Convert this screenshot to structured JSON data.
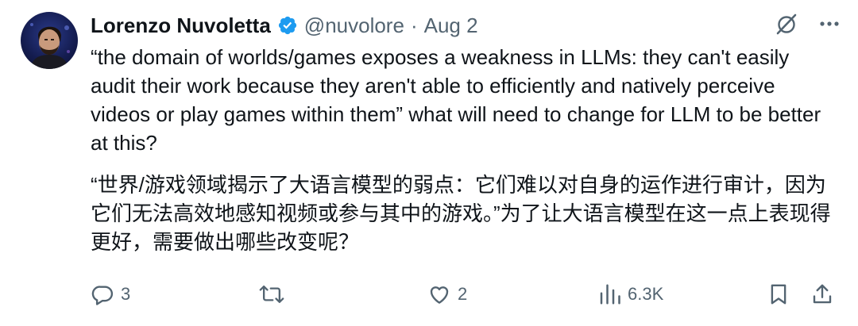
{
  "author": {
    "display_name": "Lorenzo Nuvoletta",
    "handle": "@nuvolore",
    "separator": "·",
    "date": "Aug 2"
  },
  "tweet": {
    "paragraphs": [
      "“the domain of worlds/games exposes a weakness in LLMs: they can't easily audit their work because they aren't able to efficiently and natively perceive videos or play games within them” what will need to change for LLM to be better at this?",
      "“世界/游戏领域揭示了大语言模型的弱点：它们难以对自身的运作进行审计，因为它们无法高效地感知视频或参与其中的游戏。”为了让大语言模型在这一点上表现得更好，需要做出哪些改变呢？"
    ]
  },
  "engagement": {
    "replies": "3",
    "retweets": "",
    "likes": "2",
    "views": "6.3K"
  },
  "icons": {
    "verified": "verified-badge-icon",
    "grok": "grok-slash-icon",
    "more": "more-dots-icon",
    "reply": "reply-bubble-icon",
    "retweet": "retweet-icon",
    "like": "heart-icon",
    "views": "views-bar-icon",
    "bookmark": "bookmark-icon",
    "share": "share-icon"
  },
  "colors": {
    "text_primary": "#0f1419",
    "text_secondary": "#536471",
    "verified_blue": "#1d9bf0"
  }
}
